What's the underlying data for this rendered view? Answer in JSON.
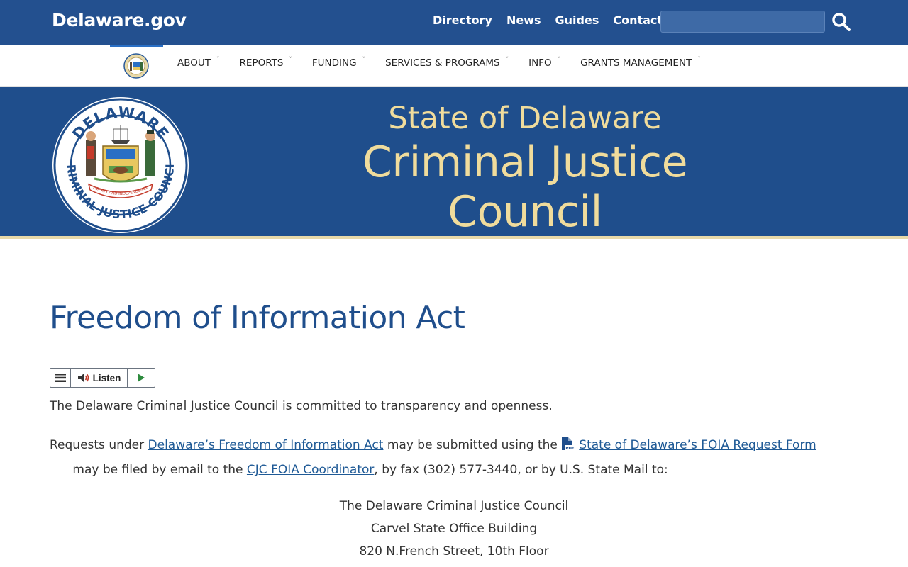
{
  "topbar": {
    "brand": "Delaware.gov",
    "links": [
      "Directory",
      "News",
      "Guides",
      "Contact"
    ],
    "search_placeholder": ""
  },
  "nav": {
    "items": [
      {
        "label": "ABOUT"
      },
      {
        "label": "REPORTS"
      },
      {
        "label": "FUNDING"
      },
      {
        "label": "SERVICES & PROGRAMS"
      },
      {
        "label": "INFO"
      },
      {
        "label": "GRANTS MANAGEMENT"
      }
    ],
    "caret": "ˇ"
  },
  "hero": {
    "subtitle": "State of Delaware",
    "title": "Criminal Justice Council",
    "seal_text_top": "DELAWARE",
    "seal_text_bottom": "CRIMINAL JUSTICE COUNCIL",
    "seal_motto": "LIBERTY AND INDEPENDENCE"
  },
  "content": {
    "page_title": "Freedom of Information Act",
    "listen_label": "Listen",
    "p1": "The Delaware Criminal Justice Council is committed to transparency and openness.",
    "p2_a": "Requests under ",
    "p2_link1": "Delaware’s Freedom of Information Act",
    "p2_b": " may be submitted using the ",
    "p2_link2": "State of Delaware’s FOIA Request Form",
    "p2_c": "      may be filed by email to the ",
    "p2_link3": "CJC FOIA Coordinator",
    "p2_d": ", by fax (302) 577-3440, or by U.S. State Mail to:",
    "address": [
      "The Delaware Criminal Justice Council",
      "Carvel State Office Building",
      "820 N.French Street, 10th Floor"
    ]
  },
  "colors": {
    "topbar": "#23508f",
    "hero": "#1f4e8c",
    "gold": "#f0dc9c",
    "link": "#1f5a96"
  }
}
